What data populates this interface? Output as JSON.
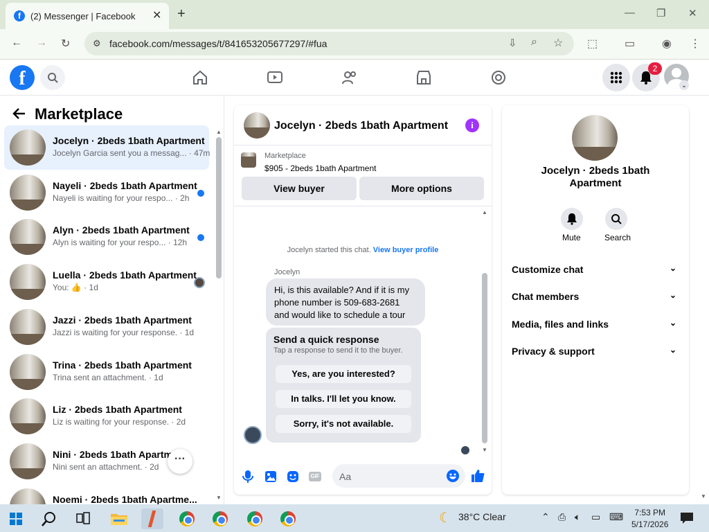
{
  "browser": {
    "tab_title": "(2) Messenger | Facebook",
    "url": "facebook.com/messages/t/841653205677297/#fua"
  },
  "nav": {
    "notification_count": "2"
  },
  "marketplace": {
    "title": "Marketplace",
    "conversations": [
      {
        "name": "Jocelyn · 2beds 1bath Apartment",
        "preview": "Jocelyn Garcia sent you a messag... · 47m",
        "unread": false,
        "active": true
      },
      {
        "name": "Nayeli · 2beds 1bath Apartment",
        "preview": "Nayeli is waiting for your respo... · 2h",
        "unread": true
      },
      {
        "name": "Alyn · 2beds 1bath Apartment",
        "preview": "Alyn is waiting for your respo... · 12h",
        "unread": true
      },
      {
        "name": "Luella · 2beds 1bath Apartment",
        "preview": "You: 👍 · 1d",
        "seen_avatar": true
      },
      {
        "name": "Jazzi · 2beds 1bath Apartment",
        "preview": "Jazzi is waiting for your response. · 1d"
      },
      {
        "name": "Trina · 2beds 1bath Apartment",
        "preview": "Trina sent an attachment. · 1d"
      },
      {
        "name": "Liz · 2beds 1bath Apartment",
        "preview": "Liz is waiting for your response. · 2d"
      },
      {
        "name": "Nini · 2beds 1bath Apartment",
        "preview": "Nini sent an attachment. · 2d"
      },
      {
        "name": "Noemi · 2beds 1bath Apartme...",
        "preview": ""
      }
    ]
  },
  "chat": {
    "title": "Jocelyn · 2beds 1bath Apartment",
    "listing_label": "Marketplace",
    "listing_price": "$905 - 2beds 1bath Apartment",
    "view_buyer": "View buyer",
    "more_options": "More options",
    "started_text": "Jocelyn started this chat.",
    "view_profile": "View buyer profile",
    "sender": "Jocelyn",
    "message": "Hi, is this available? And if it is my phone number is 509-683-2681 and would like to schedule a tour",
    "quick_title": "Send a quick response",
    "quick_sub": "Tap a response to send it to the buyer.",
    "quick_replies": [
      "Yes, are you interested?",
      "In talks. I'll let you know.",
      "Sorry, it's not available."
    ],
    "composer_placeholder": "Aa"
  },
  "info": {
    "name": "Jocelyn · 2beds 1bath Apartment",
    "mute": "Mute",
    "search": "Search",
    "sections": [
      "Customize chat",
      "Chat members",
      "Media, files and links",
      "Privacy & support"
    ]
  },
  "taskbar": {
    "weather": "38°C  Clear",
    "time": "7:53 PM",
    "date": "5/17/2026"
  }
}
